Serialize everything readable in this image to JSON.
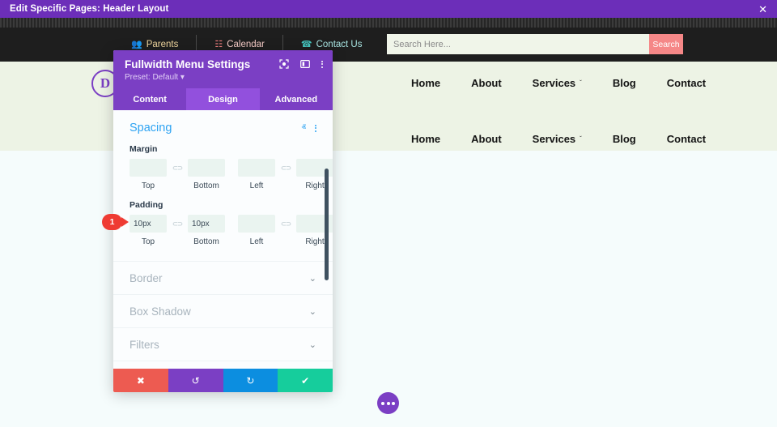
{
  "admin_bar": {
    "title": "Edit Specific Pages: Header Layout",
    "close_icon": "close-icon",
    "close_glyph": "✕"
  },
  "site_topbar": {
    "util_items": [
      {
        "label": "Parents",
        "icon": "people-icon",
        "glyph": "👥"
      },
      {
        "label": "Calendar",
        "icon": "calendar-grid-icon",
        "glyph": "☷"
      },
      {
        "label": "Contact Us",
        "icon": "phone-icon",
        "glyph": "☎"
      }
    ],
    "search": {
      "placeholder": "Search Here...",
      "value": "",
      "button_label": "Search"
    }
  },
  "site_header": {
    "logo_letter": "D",
    "nav_rows": [
      [
        {
          "label": "Home",
          "caret": false
        },
        {
          "label": "About",
          "caret": false
        },
        {
          "label": "Services",
          "caret": true
        },
        {
          "label": "Blog",
          "caret": false
        },
        {
          "label": "Contact",
          "caret": false
        }
      ],
      [
        {
          "label": "Home",
          "caret": false
        },
        {
          "label": "About",
          "caret": false
        },
        {
          "label": "Services",
          "caret": true
        },
        {
          "label": "Blog",
          "caret": false
        },
        {
          "label": "Contact",
          "caret": false
        }
      ]
    ],
    "caret_glyph": "ˇ"
  },
  "fab": {
    "name": "page-settings-fab",
    "dots": 3
  },
  "modal": {
    "title": "Fullwidth Menu Settings",
    "preset": "Preset: Default ▾",
    "header_icons": [
      {
        "name": "focus-target-icon"
      },
      {
        "name": "split-layout-icon"
      },
      {
        "name": "more-options-icon"
      }
    ],
    "tabs": [
      {
        "label": "Content",
        "active": false
      },
      {
        "label": "Design",
        "active": true
      },
      {
        "label": "Advanced",
        "active": false
      }
    ],
    "spacing": {
      "title": "Spacing",
      "collapse_glyph": "ⱏ",
      "margin": {
        "label": "Margin",
        "fields": [
          {
            "cap": "Top",
            "value": ""
          },
          {
            "cap": "Bottom",
            "value": ""
          },
          {
            "cap": "Left",
            "value": ""
          },
          {
            "cap": "Right",
            "value": ""
          }
        ]
      },
      "padding": {
        "label": "Padding",
        "fields": [
          {
            "cap": "Top",
            "value": "10px"
          },
          {
            "cap": "Bottom",
            "value": "10px"
          },
          {
            "cap": "Left",
            "value": ""
          },
          {
            "cap": "Right",
            "value": ""
          }
        ]
      },
      "link_glyph": "⊂⊃"
    },
    "collapsed_sections": [
      {
        "label": "Border"
      },
      {
        "label": "Box Shadow"
      },
      {
        "label": "Filters"
      }
    ],
    "chevron_down_glyph": "⌄",
    "footer_buttons": [
      {
        "name": "cancel-button",
        "glyph": "✖",
        "style": "cancel"
      },
      {
        "name": "undo-button",
        "glyph": "↺",
        "style": "undo"
      },
      {
        "name": "redo-button",
        "glyph": "↻",
        "style": "redo"
      },
      {
        "name": "save-button",
        "glyph": "✔",
        "style": "save"
      }
    ]
  },
  "step_badge": {
    "number": "1"
  },
  "colors": {
    "admin_purple": "#6c2eb9",
    "modal_purple": "#7b3fc4",
    "active_tab_purple": "#9250dd",
    "accent_blue": "#2ea3f2",
    "cancel_red": "#ed5b51",
    "save_green": "#16cd9c",
    "redo_blue": "#0c8ee0",
    "badge_red": "#ef3b33",
    "header_cream": "#edf3e5",
    "search_btn_red": "#f58787"
  }
}
